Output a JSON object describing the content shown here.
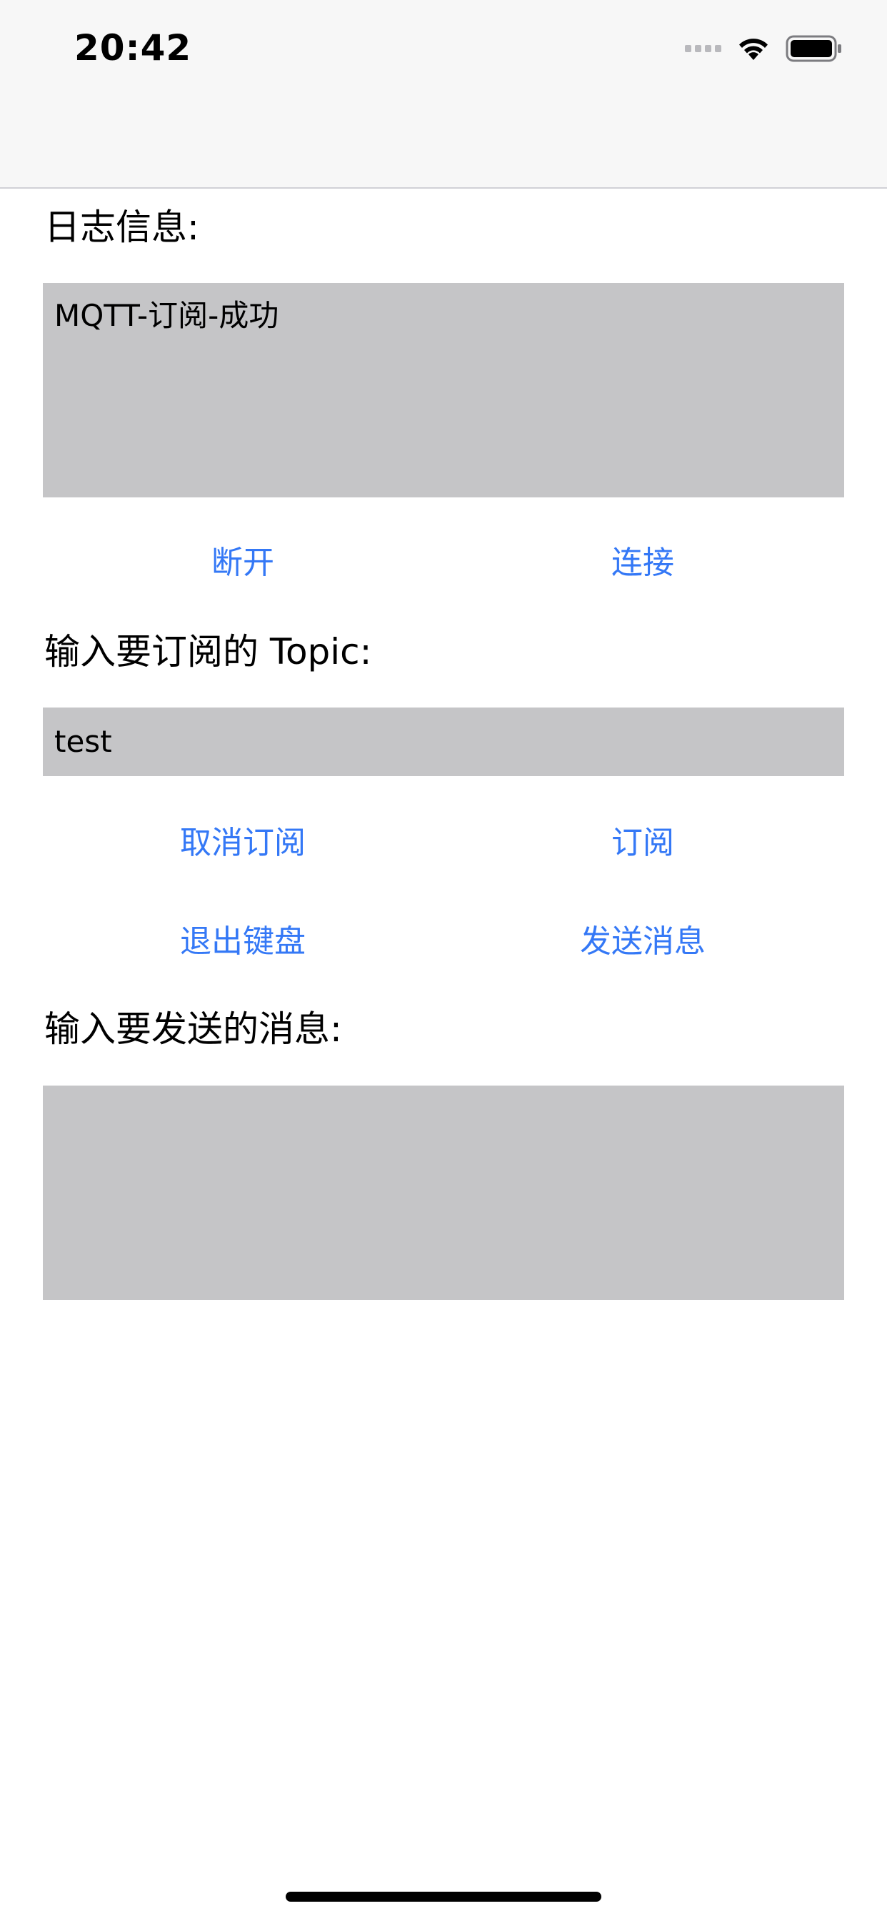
{
  "status_bar": {
    "time": "20:42",
    "icons": [
      "signal-icon",
      "wifi-icon",
      "battery-icon"
    ]
  },
  "log_section": {
    "label": "日志信息:",
    "content": "MQTT-订阅-成功"
  },
  "connection_buttons": {
    "disconnect": "断开",
    "connect": "连接"
  },
  "topic_section": {
    "label": "输入要订阅的 Topic:",
    "value": "test"
  },
  "subscribe_buttons": {
    "unsubscribe": "取消订阅",
    "subscribe": "订阅"
  },
  "action_buttons": {
    "dismiss_keyboard": "退出键盘",
    "send_message": "发送消息"
  },
  "message_section": {
    "label": "输入要发送的消息:",
    "value": ""
  },
  "colors": {
    "accent": "#3478f6",
    "field_background": "#c5c5c7",
    "nav_background": "#f7f7f7"
  }
}
